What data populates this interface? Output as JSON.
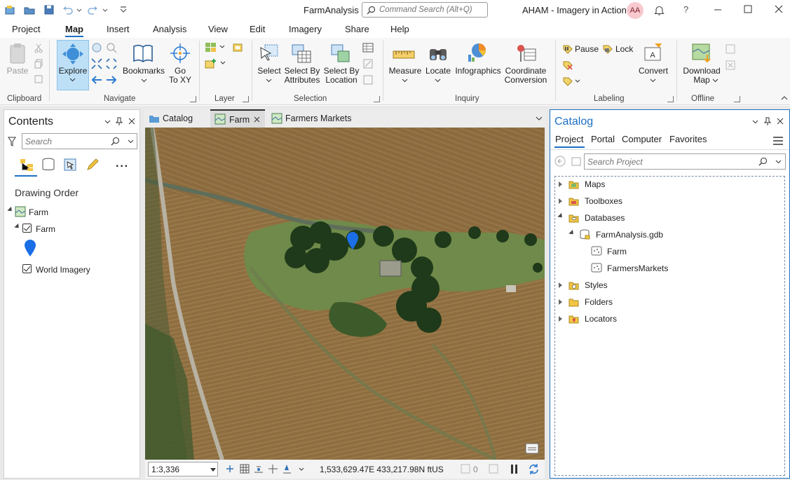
{
  "app": {
    "title": "FarmAnalysis",
    "command_search_placeholder": "Command Search (Alt+Q)",
    "user_name": "AHAM - Imagery in Action",
    "user_initials": "AA",
    "help_label": "?"
  },
  "menu": {
    "tabs": [
      "Project",
      "Map",
      "Insert",
      "Analysis",
      "View",
      "Edit",
      "Imagery",
      "Share",
      "Help"
    ],
    "active": "Map"
  },
  "ribbon": {
    "clipboard": {
      "paste": "Paste",
      "group": "Clipboard"
    },
    "navigate": {
      "explore": "Explore",
      "bookmarks": "Bookmarks",
      "go_to_xy": "Go\nTo XY",
      "group": "Navigate"
    },
    "layer": {
      "group": "Layer"
    },
    "selection": {
      "select": "Select",
      "select_by_attributes": "Select By\nAttributes",
      "select_by_location": "Select By\nLocation",
      "group": "Selection"
    },
    "inquiry": {
      "measure": "Measure",
      "locate": "Locate",
      "infographics": "Infographics",
      "coordinate_conversion": "Coordinate\nConversion",
      "group": "Inquiry"
    },
    "labeling": {
      "pause": "Pause",
      "lock": "Lock",
      "convert": "Convert",
      "group": "Labeling"
    },
    "offline": {
      "download_map": "Download\nMap",
      "group": "Offline"
    }
  },
  "contents": {
    "title": "Contents",
    "search_placeholder": "Search",
    "section": "Drawing Order",
    "map_name": "Farm",
    "layers": [
      {
        "name": "Farm",
        "checked": true
      },
      {
        "name": "World Imagery",
        "checked": true
      }
    ],
    "colors": {
      "symbol": "#1a6ee6",
      "accent": "#1c6fc4"
    }
  },
  "views": {
    "tabs": [
      "Catalog",
      "Farm",
      "Farmers Markets"
    ],
    "active": "Farm"
  },
  "statusbar": {
    "scale": "1:3,336",
    "coordinates": "1,533,629.47E 433,217.98N ftUS",
    "selected_count": "0"
  },
  "catalog": {
    "title": "Catalog",
    "tabs": [
      "Project",
      "Portal",
      "Computer",
      "Favorites"
    ],
    "active_tab": "Project",
    "search_placeholder": "Search Project",
    "items": [
      {
        "label": "Maps",
        "expanded": false,
        "level": 0
      },
      {
        "label": "Toolboxes",
        "expanded": false,
        "level": 0
      },
      {
        "label": "Databases",
        "expanded": true,
        "level": 0
      },
      {
        "label": "FarmAnalysis.gdb",
        "expanded": true,
        "level": 1
      },
      {
        "label": "Farm",
        "level": 2
      },
      {
        "label": "FarmersMarkets",
        "level": 2
      },
      {
        "label": "Styles",
        "expanded": false,
        "level": 0
      },
      {
        "label": "Folders",
        "expanded": false,
        "level": 0
      },
      {
        "label": "Locators",
        "expanded": false,
        "level": 0
      }
    ]
  }
}
